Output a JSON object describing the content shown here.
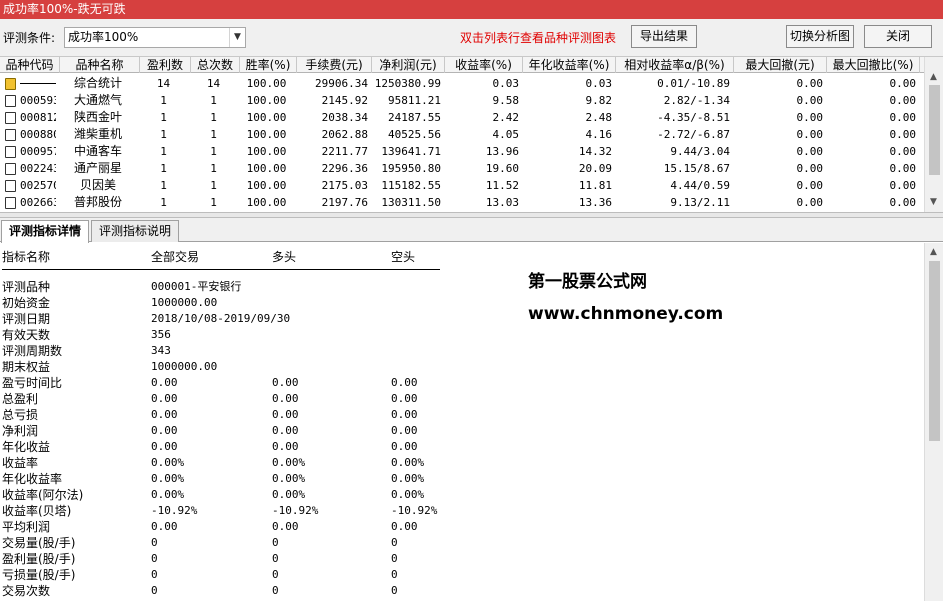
{
  "window": {
    "title": "成功率100%-跌无可跌"
  },
  "toolbar": {
    "condition_label": "评测条件:",
    "condition_value": "成功率100%",
    "hint": "双击列表行查看品种评测图表",
    "export_label": "导出结果",
    "switch_label": "切换分析图",
    "close_label": "关闭"
  },
  "table": {
    "columns": [
      "品种代码",
      "品种名称",
      "盈利数",
      "总次数",
      "胜率(%)",
      "手续费(元)",
      "净利润(元)",
      "收益率(%)",
      "年化收益率(%)",
      "相对收益率α/β(%)",
      "最大回撤(元)",
      "最大回撤比(%)"
    ],
    "rows": [
      {
        "code": "",
        "name": "综合统计",
        "wins": "14",
        "total": "14",
        "winrate": "100.00",
        "fee": "29906.34",
        "profit": "1250380.99",
        "ret": "0.03",
        "annual": "0.03",
        "relative": "0.01/-10.89",
        "maxdd": "0.00",
        "maxddpct": "0.00",
        "summary": true
      },
      {
        "code": "000593",
        "name": "大通燃气",
        "wins": "1",
        "total": "1",
        "winrate": "100.00",
        "fee": "2145.92",
        "profit": "95811.21",
        "ret": "9.58",
        "annual": "9.82",
        "relative": "2.82/-1.34",
        "maxdd": "0.00",
        "maxddpct": "0.00"
      },
      {
        "code": "000812",
        "name": "陕西金叶",
        "wins": "1",
        "total": "1",
        "winrate": "100.00",
        "fee": "2038.34",
        "profit": "24187.55",
        "ret": "2.42",
        "annual": "2.48",
        "relative": "-4.35/-8.51",
        "maxdd": "0.00",
        "maxddpct": "0.00"
      },
      {
        "code": "000880",
        "name": "潍柴重机",
        "wins": "1",
        "total": "1",
        "winrate": "100.00",
        "fee": "2062.88",
        "profit": "40525.56",
        "ret": "4.05",
        "annual": "4.16",
        "relative": "-2.72/-6.87",
        "maxdd": "0.00",
        "maxddpct": "0.00"
      },
      {
        "code": "000957",
        "name": "中通客车",
        "wins": "1",
        "total": "1",
        "winrate": "100.00",
        "fee": "2211.77",
        "profit": "139641.71",
        "ret": "13.96",
        "annual": "14.32",
        "relative": "9.44/3.04",
        "maxdd": "0.00",
        "maxddpct": "0.00"
      },
      {
        "code": "002243",
        "name": "通产丽星",
        "wins": "1",
        "total": "1",
        "winrate": "100.00",
        "fee": "2296.36",
        "profit": "195950.80",
        "ret": "19.60",
        "annual": "20.09",
        "relative": "15.15/8.67",
        "maxdd": "0.00",
        "maxddpct": "0.00"
      },
      {
        "code": "002570",
        "name": "贝因美",
        "wins": "1",
        "total": "1",
        "winrate": "100.00",
        "fee": "2175.03",
        "profit": "115182.55",
        "ret": "11.52",
        "annual": "11.81",
        "relative": "4.44/0.59",
        "maxdd": "0.00",
        "maxddpct": "0.00"
      },
      {
        "code": "002663",
        "name": "普邦股份",
        "wins": "1",
        "total": "1",
        "winrate": "100.00",
        "fee": "2197.76",
        "profit": "130311.50",
        "ret": "13.03",
        "annual": "13.36",
        "relative": "9.13/2.11",
        "maxdd": "0.00",
        "maxddpct": "0.00"
      }
    ]
  },
  "tabs": {
    "detail": "评测指标详情",
    "explain": "评测指标说明"
  },
  "detail": {
    "headers": [
      "指标名称",
      "全部交易",
      "多头",
      "空头"
    ],
    "rows": [
      {
        "name": "评测品种",
        "all": "000001-平安银行",
        "long": "",
        "short": ""
      },
      {
        "name": "初始资金",
        "all": "1000000.00",
        "long": "",
        "short": ""
      },
      {
        "name": "评测日期",
        "all": "2018/10/08-2019/09/30",
        "long": "",
        "short": ""
      },
      {
        "name": "有效天数",
        "all": "356",
        "long": "",
        "short": ""
      },
      {
        "name": "评测周期数",
        "all": "343",
        "long": "",
        "short": ""
      },
      {
        "name": "期末权益",
        "all": "1000000.00",
        "long": "",
        "short": ""
      },
      {
        "name": "盈亏时间比",
        "all": "0.00",
        "long": "0.00",
        "short": "0.00"
      },
      {
        "name": "总盈利",
        "all": "0.00",
        "long": "0.00",
        "short": "0.00"
      },
      {
        "name": "总亏损",
        "all": "0.00",
        "long": "0.00",
        "short": "0.00"
      },
      {
        "name": "净利润",
        "all": "0.00",
        "long": "0.00",
        "short": "0.00"
      },
      {
        "name": "年化收益",
        "all": "0.00",
        "long": "0.00",
        "short": "0.00"
      },
      {
        "name": "收益率",
        "all": "0.00%",
        "long": "0.00%",
        "short": "0.00%"
      },
      {
        "name": "年化收益率",
        "all": "0.00%",
        "long": "0.00%",
        "short": "0.00%"
      },
      {
        "name": "收益率(阿尔法)",
        "all": "0.00%",
        "long": "0.00%",
        "short": "0.00%"
      },
      {
        "name": "收益率(贝塔)",
        "all": "-10.92%",
        "long": "-10.92%",
        "short": "-10.92%"
      },
      {
        "name": "平均利润",
        "all": "0.00",
        "long": "0.00",
        "short": "0.00"
      },
      {
        "name": "交易量(股/手)",
        "all": "0",
        "long": "0",
        "short": "0"
      },
      {
        "name": "盈利量(股/手)",
        "all": "0",
        "long": "0",
        "short": "0"
      },
      {
        "name": "亏损量(股/手)",
        "all": "0",
        "long": "0",
        "short": "0"
      },
      {
        "name": "交易次数",
        "all": "0",
        "long": "0",
        "short": "0"
      }
    ]
  },
  "watermark": {
    "line1": "第一股票公式网",
    "line2": "www.chnmoney.com"
  }
}
